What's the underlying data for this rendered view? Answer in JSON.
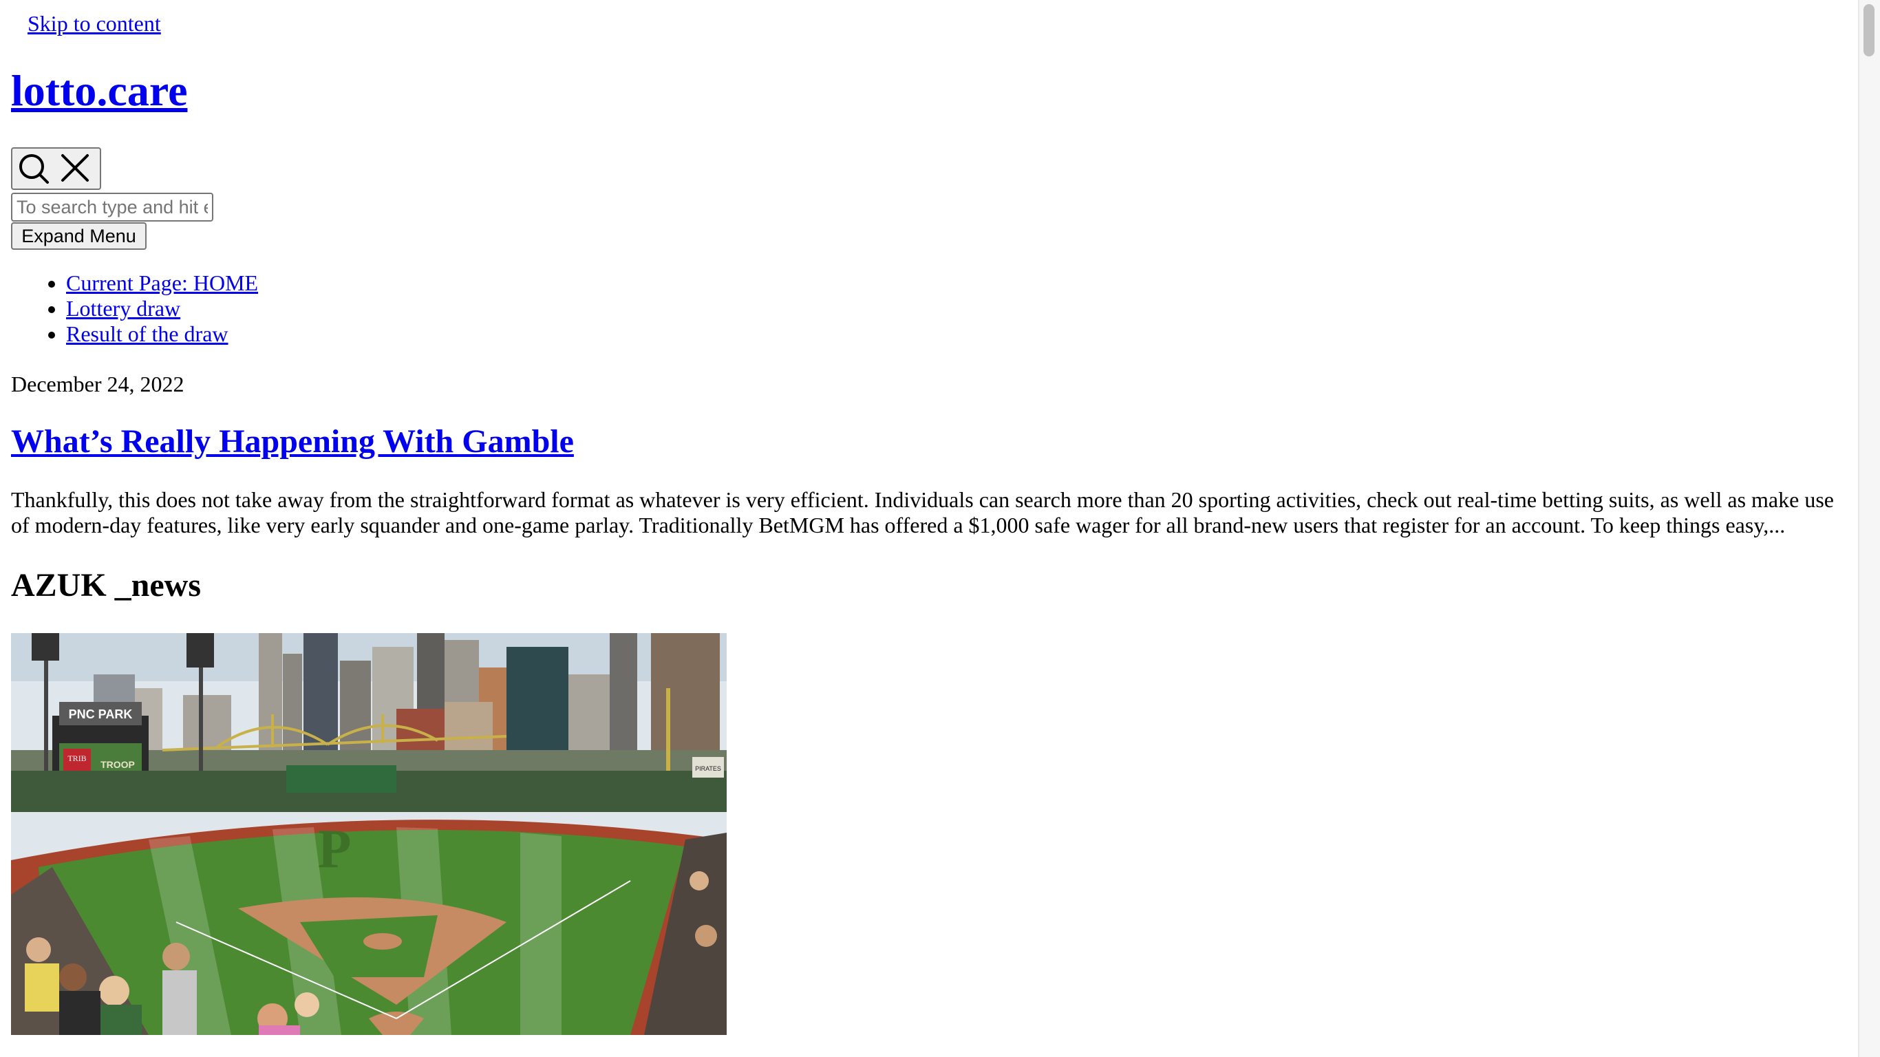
{
  "skip_link": "Skip to content",
  "site": {
    "title": "lotto.care"
  },
  "search": {
    "toggle_icons": [
      "search-icon",
      "close-icon"
    ],
    "placeholder": "To search type and hit enter"
  },
  "menu": {
    "expand_label": "Expand Menu",
    "items": [
      {
        "label": "Current Page: HOME"
      },
      {
        "label": "Lottery draw"
      },
      {
        "label": "Result of the draw"
      }
    ]
  },
  "post": {
    "date": "December 24, 2022",
    "title": "What’s Really Happening With Gamble",
    "excerpt": "Thankfully, this does not take away from the straightforward format as whatever is very efficient. Individuals can search more than 20 sporting activities, check out real-time betting suits, as well as make use of modern-day features, like very early squander and one-game parlay. Traditionally BetMGM has offered a $1,000 safe wager for all brand-new users that register for an account. To keep things easy,..."
  },
  "section": {
    "heading": "AZUK _news"
  },
  "image": {
    "scoreboard_text": "PNC PARK",
    "sign_text_1": "TRIB",
    "sign_text_2": "TROOP",
    "sign_text_3": "PIRATES"
  },
  "colors": {
    "link": "#0000ee",
    "button_bg": "#efefef",
    "button_border": "#767676",
    "grass": "#4c8a32",
    "infield_dirt": "#c68b63",
    "warning_track": "#a9442c",
    "sky": "#dfe6ec"
  }
}
